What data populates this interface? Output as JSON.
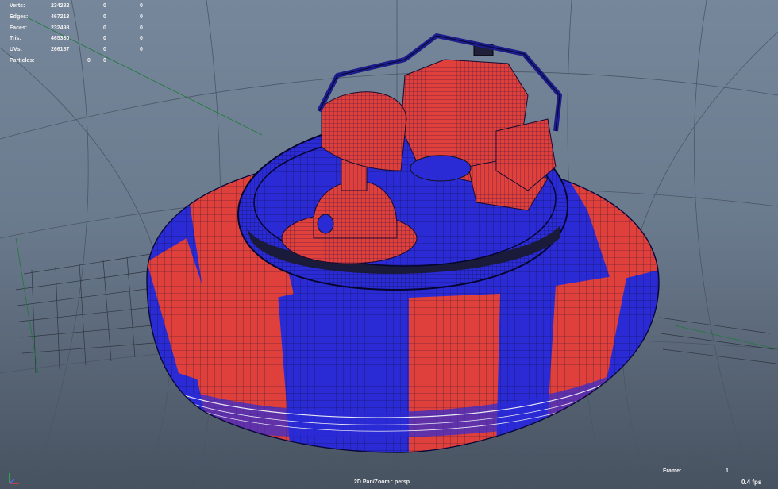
{
  "app": "Maya viewport",
  "stats": {
    "verts": {
      "label": "Verts:",
      "v1": "234282",
      "v2": "0",
      "v3": "0"
    },
    "edges": {
      "label": "Edges:",
      "v1": "467213",
      "v2": "0",
      "v3": "0"
    },
    "faces": {
      "label": "Faces:",
      "v1": "232498",
      "v2": "0",
      "v3": "0"
    },
    "tris": {
      "label": "Tris:",
      "v1": "465330",
      "v2": "0",
      "v3": "0"
    },
    "uvs": {
      "label": "UVs:",
      "v1": "266187",
      "v2": "0",
      "v3": "0"
    },
    "particles": {
      "label": "Particles:",
      "v2": "0",
      "v3": "0"
    }
  },
  "frame": {
    "label": "Frame:",
    "value": "1"
  },
  "fps": "0.4 fps",
  "camera_label": "2D Pan/Zoom : persp",
  "colors": {
    "viewport_top": "#76879b",
    "viewport_bottom": "#475260",
    "mesh_red": "#e0403c",
    "mesh_blue": "#2b2bd6",
    "wire": "#10104a",
    "grid": "#3c4652",
    "axis_green": "#1f7a3a"
  },
  "icons": {
    "axis_gizmo": "xyz-axis-icon"
  }
}
